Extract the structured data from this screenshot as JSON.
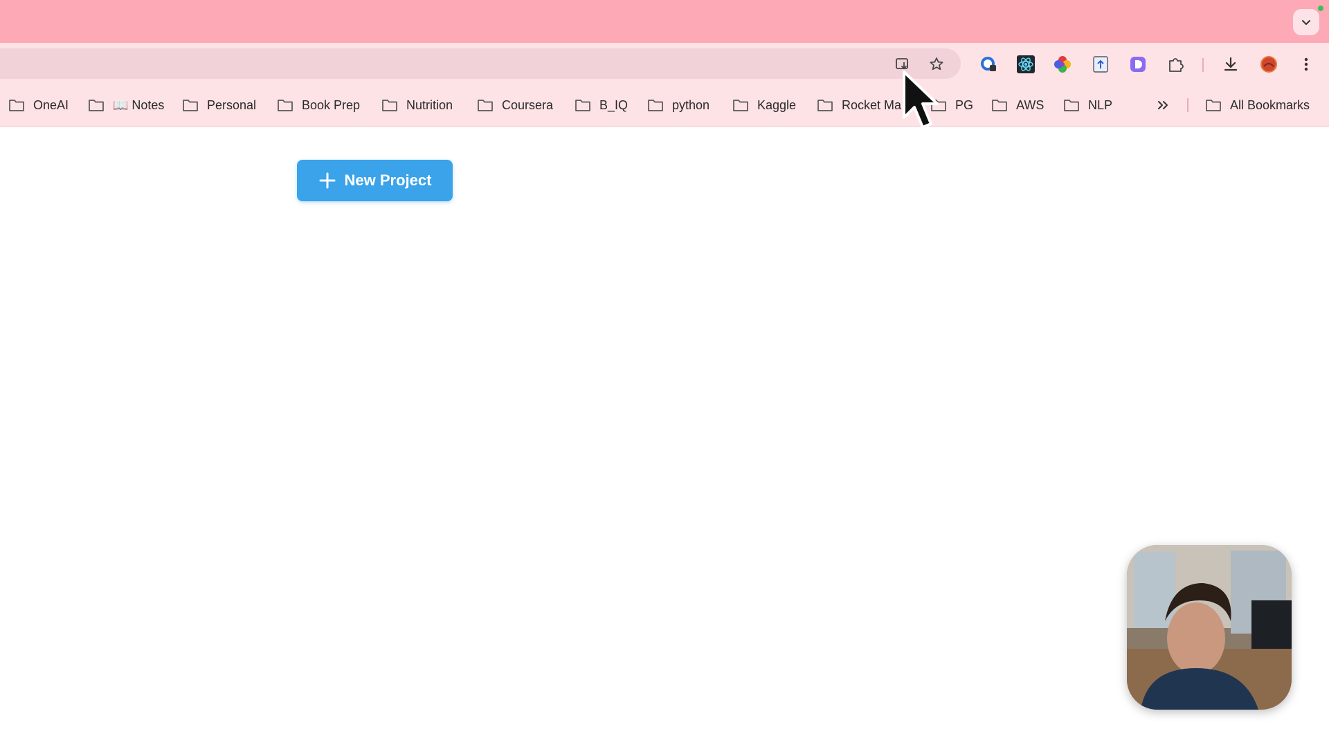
{
  "colors": {
    "tabstrip": "#fda9b6",
    "toolbar": "#fde2e6",
    "omnibox": "#f0d2d8",
    "primary_button": "#3aa3ea"
  },
  "toolbar": {
    "omnibox_icons": [
      "install-app-icon",
      "bookmark-star-icon"
    ],
    "extensions": [
      "password-manager-extension-icon",
      "react-devtools-extension-icon",
      "color-picker-extension-icon",
      "upload-extension-icon",
      "d-extension-icon",
      "extensions-puzzle-icon"
    ],
    "actions": [
      "download-icon",
      "profile-avatar",
      "menu-kebab-icon"
    ]
  },
  "bookmarks": {
    "items": [
      {
        "label": "OneAI"
      },
      {
        "label": "📖 Notes"
      },
      {
        "label": "Personal"
      },
      {
        "label": "Book Prep"
      },
      {
        "label": "Nutrition"
      },
      {
        "label": "Coursera"
      },
      {
        "label": "B_IQ"
      },
      {
        "label": "python"
      },
      {
        "label": "Kaggle"
      },
      {
        "label": "Rocket Ma"
      },
      {
        "label": "PG"
      },
      {
        "label": "AWS"
      },
      {
        "label": "NLP"
      }
    ],
    "overflow_icon": "chevrons-right-icon",
    "all_bookmarks": "All Bookmarks"
  },
  "page": {
    "new_project_label": "New Project"
  },
  "webcam": {
    "description_icon": "webcam-overlay"
  }
}
